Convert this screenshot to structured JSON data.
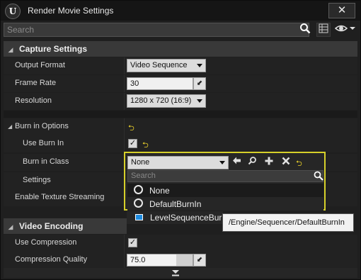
{
  "window": {
    "title": "Render Movie Settings",
    "close_glyph": "✕"
  },
  "search": {
    "placeholder": "Search"
  },
  "capture": {
    "header": "Capture Settings",
    "output_format": {
      "label": "Output Format",
      "value": "Video Sequence"
    },
    "frame_rate": {
      "label": "Frame Rate",
      "value": "30"
    },
    "resolution": {
      "label": "Resolution",
      "value": "1280 x 720 (16:9)"
    }
  },
  "burn_in": {
    "header": "Burn in Options",
    "use_burn_in": {
      "label": "Use Burn In",
      "checked": true
    },
    "class": {
      "label": "Burn in Class",
      "value": "None"
    },
    "settings": {
      "label": "Settings"
    }
  },
  "texture_streaming": {
    "label": "Enable Texture Streaming"
  },
  "class_picker": {
    "search_placeholder": "Search",
    "options": [
      "None",
      "DefaultBurnIn"
    ],
    "child": "LevelSequenceBur",
    "tooltip": "/Engine/Sequencer/DefaultBurnIn"
  },
  "encoding": {
    "header": "Video Encoding",
    "use_compression": {
      "label": "Use Compression",
      "checked": true
    },
    "quality": {
      "label": "Compression Quality",
      "value": "75.0",
      "level": 0.75
    }
  },
  "colors": {
    "accent": "#d6d02a",
    "reset": "#e8cf2a",
    "selection": "#1d8be0"
  },
  "icons": [
    "unreal-logo-icon",
    "close-icon",
    "search-icon",
    "grid-view-icon",
    "eye-icon",
    "dropdown-arrow-icon",
    "reset-to-default-icon",
    "checkmark-icon",
    "drag-handle-icon",
    "back-arrow-icon",
    "browse-icon",
    "add-icon",
    "clear-icon",
    "radio-icon",
    "class-icon",
    "expand-icon"
  ]
}
